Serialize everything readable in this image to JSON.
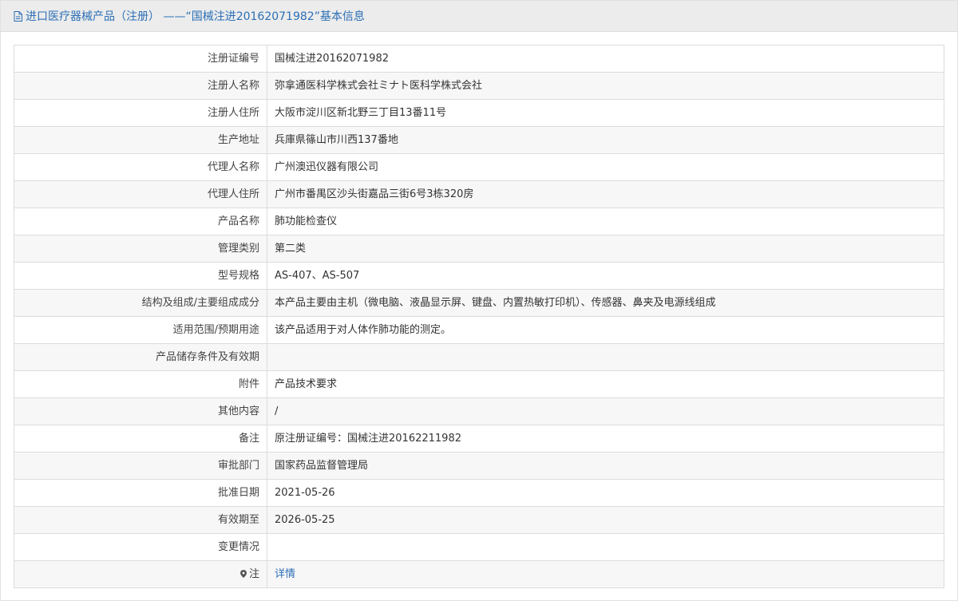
{
  "header": {
    "title": "进口医疗器械产品（注册） ——“国械注进20162071982”基本信息"
  },
  "rows": [
    {
      "label": "注册证编号",
      "value": "国械注进20162071982"
    },
    {
      "label": "注册人名称",
      "value": "弥拿通医科学株式会社ミナト医科学株式会社"
    },
    {
      "label": "注册人住所",
      "value": "大阪市淀川区新北野三丁目13番11号"
    },
    {
      "label": "生产地址",
      "value": "兵庫県篠山市川西137番地"
    },
    {
      "label": "代理人名称",
      "value": "广州澳迅仪器有限公司"
    },
    {
      "label": "代理人住所",
      "value": "广州市番禺区沙头街嘉品三街6号3栋320房"
    },
    {
      "label": "产品名称",
      "value": "肺功能检查仪"
    },
    {
      "label": "管理类别",
      "value": "第二类"
    },
    {
      "label": "型号规格",
      "value": "AS-407、AS-507"
    },
    {
      "label": "结构及组成/主要组成成分",
      "value": "本产品主要由主机（微电脑、液晶显示屏、键盘、内置热敏打印机）、传感器、鼻夹及电源线组成"
    },
    {
      "label": "适用范围/预期用途",
      "value": "该产品适用于对人体作肺功能的测定。"
    },
    {
      "label": "产品储存条件及有效期",
      "value": ""
    },
    {
      "label": "附件",
      "value": "产品技术要求"
    },
    {
      "label": "其他内容",
      "value": "/"
    },
    {
      "label": "备注",
      "value": "原注册证编号：国械注进20162211982"
    },
    {
      "label": "审批部门",
      "value": "国家药品监督管理局"
    },
    {
      "label": "批准日期",
      "value": "2021-05-26"
    },
    {
      "label": "有效期至",
      "value": "2026-05-25"
    },
    {
      "label": "变更情况",
      "value": ""
    }
  ],
  "note_row": {
    "icon": "pin-icon",
    "label": "注",
    "link_text": "详情"
  },
  "colors": {
    "accent": "#2c6fb6",
    "header_bg": "#ececec",
    "row_alt_bg": "#f7f7f7",
    "border": "#dcdcdc"
  }
}
